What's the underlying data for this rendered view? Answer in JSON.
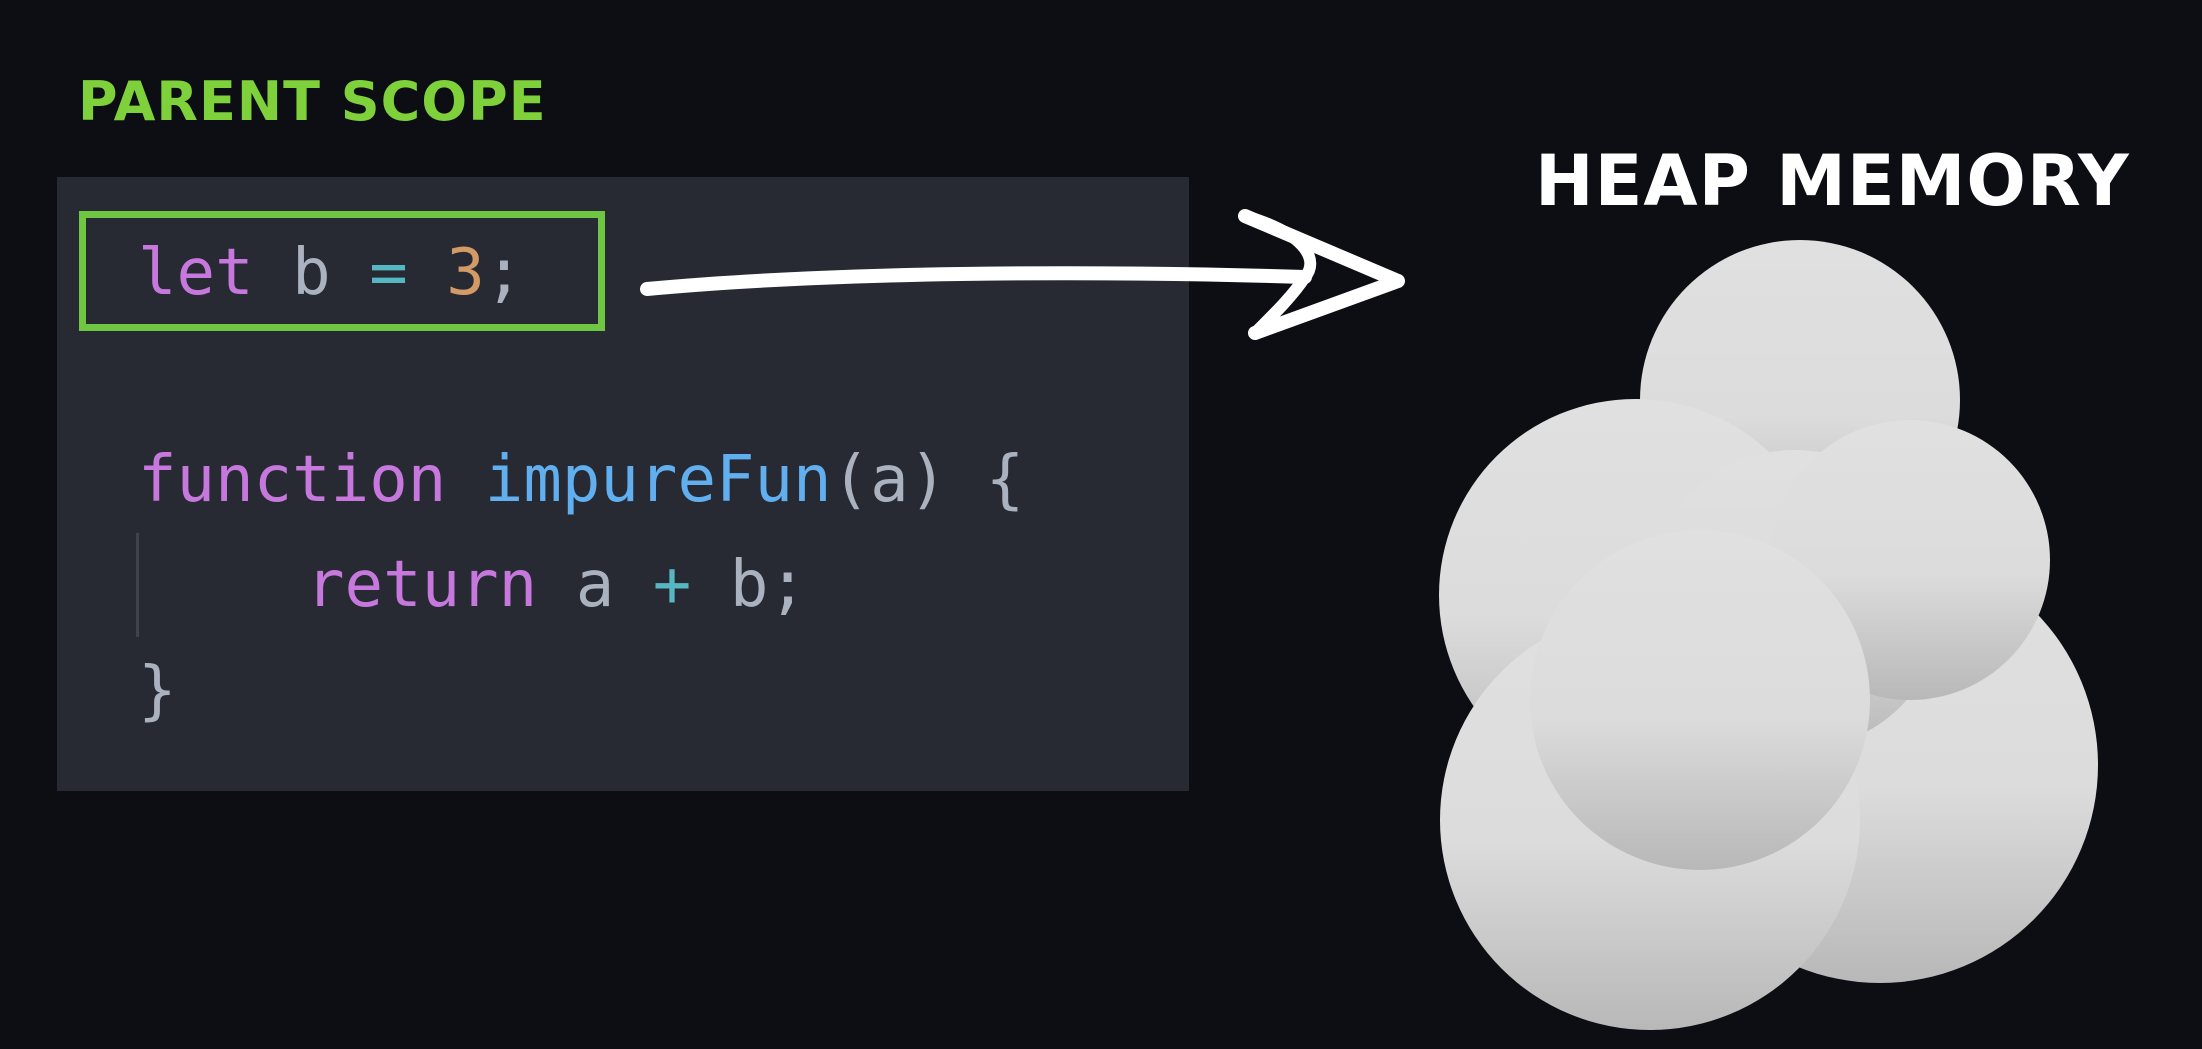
{
  "labels": {
    "parent_scope": "PARENT SCOPE",
    "heap_memory": "HEAP MEMORY"
  },
  "code": {
    "line1": {
      "kw": "let",
      "var": " b ",
      "op": "=",
      "sp": " ",
      "num": "3",
      "end": ";"
    },
    "line3": {
      "kw": "function",
      "sp": " ",
      "fn": "impureFun",
      "args": "(a) {"
    },
    "line4": {
      "kw": "return",
      "a": " a ",
      "op": "+",
      "end": " b;"
    },
    "line5": {
      "close": "}"
    }
  },
  "colors": {
    "background": "#0d0d14",
    "panel": "#272a33",
    "highlight_border": "#6fc642",
    "parent_scope_label": "#7fd13b",
    "keyword": "#c678dd",
    "function_name": "#61afef",
    "operator": "#56b6c2",
    "number": "#d19a66",
    "text": "#abb2bf",
    "cloud_top": "#e0e0e0",
    "cloud_bottom": "#b8b8b8"
  },
  "icons": {
    "arrow": "hand-drawn-arrow-icon",
    "cloud": "cloud-icon"
  }
}
